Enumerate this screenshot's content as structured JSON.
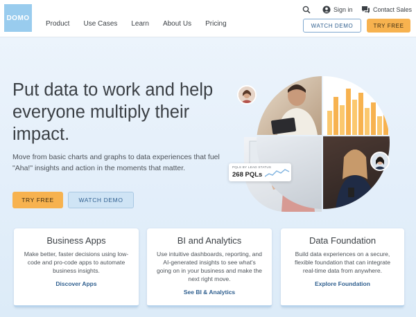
{
  "header": {
    "logo_text": "DOMO",
    "nav": [
      "Product",
      "Use Cases",
      "Learn",
      "About Us",
      "Pricing"
    ],
    "search_icon": "search-icon",
    "sign_in": "Sign in",
    "contact_sales": "Contact Sales",
    "watch_demo": "WATCH DEMO",
    "try_free": "TRY FREE"
  },
  "hero": {
    "title": "Put data to work and help everyone multiply their impact.",
    "subtitle": "Move from basic charts and graphs to data experiences that fuel \"Aha!\" insights and action in the moments that matter.",
    "try_free": "TRY FREE",
    "watch_demo": "WATCH DEMO"
  },
  "collage": {
    "pql_label": "PQLS BY LEAD STATUS",
    "pql_value": "268 PQLs"
  },
  "cards": [
    {
      "title": "Business Apps",
      "description": "Make better, faster decisions using low-code and pro-code apps to automate business insights.",
      "link": "Discover Apps"
    },
    {
      "title": "BI and Analytics",
      "description": "Use intuitive dashboards, reporting, and AI-generated insights to see what's going on in your business and make the next right move.",
      "link": "See BI & Analytics"
    },
    {
      "title": "Data Foundation",
      "description": "Build data experiences on a secure, flexible foundation that can integrate real-time data from anywhere.",
      "link": "Explore Foundation"
    }
  ],
  "colors": {
    "accent_orange": "#f7b24f",
    "link_blue": "#2f5f8f",
    "logo_blue": "#99ccee"
  }
}
